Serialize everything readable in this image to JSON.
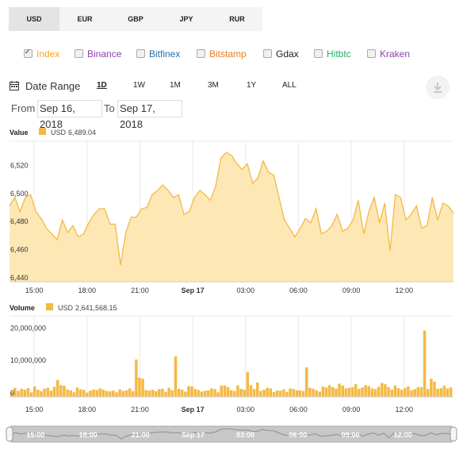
{
  "currency_tabs": [
    "USD",
    "EUR",
    "GBP",
    "JPY",
    "RUR"
  ],
  "active_currency": "USD",
  "exchanges": [
    {
      "label": "Index",
      "color": "#f5a623",
      "checked": true
    },
    {
      "label": "Binance",
      "color": "#8e44ad",
      "checked": false
    },
    {
      "label": "Bitfinex",
      "color": "#2c6ea8",
      "checked": false
    },
    {
      "label": "Bitstamp",
      "color": "#e67e22",
      "checked": false
    },
    {
      "label": "Gdax",
      "color": "#222222",
      "checked": false
    },
    {
      "label": "Hitbtc",
      "color": "#27ae60",
      "checked": false
    },
    {
      "label": "Kraken",
      "color": "#8e44ad",
      "checked": false
    }
  ],
  "date_range": {
    "label": "Date Range",
    "buttons": [
      "1D",
      "1W",
      "1M",
      "3M",
      "1Y",
      "ALL"
    ],
    "active": "1D"
  },
  "from": {
    "label": "From",
    "value": "Sep 16, 2018"
  },
  "to": {
    "label": "To",
    "value": "Sep 17, 2018"
  },
  "colors": {
    "accent": "#f5b942",
    "fill": "#fde7b5",
    "grid": "#e9e9e9"
  },
  "chart_data": [
    {
      "type": "area",
      "title": "Value",
      "legend": {
        "name": "USD",
        "value": "6,489.04"
      },
      "ylim": [
        6440,
        6540
      ],
      "y_ticks": [
        "6,440",
        "6,460",
        "6,480",
        "6,500",
        "6,520"
      ],
      "x_ticks": [
        "15:00",
        "18:00",
        "21:00",
        "Sep 17",
        "03:00",
        "06:00",
        "09:00",
        "12:00"
      ],
      "x_bold": "Sep 17",
      "x_range": [
        -1.4,
        23.8
      ],
      "x": [
        -1.4,
        -1.1,
        -0.8,
        -0.5,
        -0.2,
        0.1,
        0.4,
        0.7,
        1.0,
        1.3,
        1.6,
        1.9,
        2.2,
        2.5,
        2.8,
        3.1,
        3.4,
        3.7,
        4.0,
        4.3,
        4.6,
        4.9,
        5.2,
        5.5,
        5.8,
        6.1,
        6.4,
        6.7,
        7.0,
        7.3,
        7.6,
        7.9,
        8.2,
        8.5,
        8.8,
        9.1,
        9.4,
        9.7,
        10.0,
        10.3,
        10.6,
        10.9,
        11.2,
        11.5,
        11.8,
        12.1,
        12.4,
        12.7,
        13.0,
        13.3,
        13.6,
        13.9,
        14.2,
        14.5,
        14.8,
        15.1,
        15.4,
        15.7,
        16.0,
        16.3,
        16.6,
        16.9,
        17.2,
        17.5,
        17.8,
        18.1,
        18.4,
        18.7,
        19.0,
        19.3,
        19.6,
        19.9,
        20.2,
        20.5,
        20.8,
        21.1,
        21.4,
        21.7,
        22.0,
        22.3,
        22.6,
        22.9,
        23.2,
        23.5,
        23.8
      ],
      "values": [
        6494,
        6500,
        6490,
        6500,
        6502,
        6490,
        6485,
        6478,
        6474,
        6470,
        6484,
        6475,
        6480,
        6472,
        6474,
        6482,
        6488,
        6492,
        6492,
        6481,
        6481,
        6452,
        6475,
        6486,
        6486,
        6492,
        6493,
        6502,
        6505,
        6509,
        6505,
        6500,
        6502,
        6488,
        6490,
        6500,
        6505,
        6502,
        6498,
        6508,
        6528,
        6532,
        6530,
        6524,
        6520,
        6524,
        6510,
        6514,
        6526,
        6518,
        6516,
        6500,
        6484,
        6478,
        6472,
        6478,
        6485,
        6482,
        6492,
        6474,
        6476,
        6480,
        6488,
        6476,
        6478,
        6484,
        6498,
        6474,
        6490,
        6500,
        6482,
        6496,
        6462,
        6502,
        6500,
        6484,
        6488,
        6494,
        6478,
        6480,
        6500,
        6484,
        6496,
        6494,
        6489
      ]
    },
    {
      "type": "bar",
      "title": "Volume",
      "legend": {
        "name": "USD",
        "value": "2,641,568.15"
      },
      "ylim": [
        0,
        25000000
      ],
      "y_ticks": [
        "0",
        "10,000,000",
        "20,000,000"
      ],
      "x_ticks": [
        "15:00",
        "18:00",
        "21:00",
        "Sep 17",
        "03:00",
        "06:00",
        "09:00",
        "12:00"
      ],
      "x_bold": "Sep 17",
      "x_range": [
        -1.4,
        23.8
      ],
      "values": [
        1500000,
        2800000,
        1800000,
        2500000,
        2200000,
        2700000,
        1400000,
        3200000,
        2200000,
        1700000,
        2500000,
        2800000,
        1900000,
        3100000,
        5200000,
        3600000,
        3400000,
        2300000,
        2000000,
        1400000,
        2900000,
        2300000,
        2100000,
        1300000,
        1900000,
        2200000,
        2100000,
        2600000,
        2200000,
        1800000,
        1700000,
        1900000,
        1400000,
        2300000,
        1800000,
        2000000,
        2600000,
        1800000,
        11500000,
        5900000,
        5600000,
        2100000,
        1900000,
        2200000,
        1800000,
        2400000,
        2500000,
        1600000,
        2800000,
        2000000,
        12500000,
        2500000,
        2200000,
        1600000,
        3300000,
        3200000,
        2400000,
        2100000,
        1600000,
        1900000,
        2000000,
        2600000,
        2400000,
        1400000,
        3500000,
        3500000,
        3000000,
        2100000,
        1800000,
        3500000,
        2500000,
        2200000,
        7600000,
        3600000,
        2400000,
        4400000,
        1800000,
        2200000,
        2800000,
        2600000,
        1500000,
        1900000,
        1900000,
        2300000,
        1500000,
        2600000,
        2400000,
        2000000,
        2000000,
        1800000,
        9100000,
        2800000,
        2500000,
        2000000,
        1600000,
        3200000,
        2900000,
        3600000,
        3000000,
        2500000,
        4100000,
        3500000,
        2600000,
        2800000,
        3000000,
        3900000,
        2500000,
        2900000,
        3600000,
        3300000,
        2600000,
        2400000,
        3100000,
        4300000,
        3900000,
        3000000,
        2200000,
        3500000,
        2700000,
        2200000,
        2700000,
        3200000,
        2000000,
        2400000,
        3000000,
        3000000,
        20500000,
        2400000,
        5600000,
        4700000,
        2500000,
        2700000,
        3400000,
        2600000,
        2900000
      ]
    }
  ],
  "navigator": {
    "x_ticks": [
      "15:00",
      "18:00",
      "21:00",
      "Sep 17",
      "03:00",
      "06:00",
      "09:00",
      "12:00"
    ]
  }
}
